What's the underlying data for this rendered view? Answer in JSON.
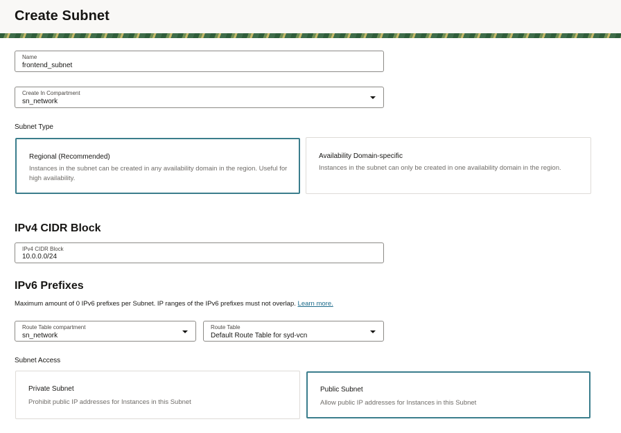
{
  "header": {
    "title": "Create Subnet"
  },
  "name_field": {
    "label": "Name",
    "value": "frontend_subnet"
  },
  "compartment_field": {
    "label": "Create In Compartment",
    "value": "sn_network"
  },
  "subnet_type": {
    "label": "Subnet Type",
    "options": [
      {
        "title": "Regional (Recommended)",
        "description": "Instances in the subnet can be created in any availability domain in the region. Useful for high availability.",
        "selected": true
      },
      {
        "title": "Availability Domain-specific",
        "description": "Instances in the subnet can only be created in one availability domain in the region.",
        "selected": false
      }
    ]
  },
  "ipv4": {
    "heading": "IPv4 CIDR Block",
    "field": {
      "label": "IPv4 CIDR Block",
      "value": "10.0.0.0/24"
    }
  },
  "ipv6": {
    "heading": "IPv6 Prefixes",
    "description": "Maximum amount of 0 IPv6 prefixes per Subnet. IP ranges of the IPv6 prefixes must not overlap.",
    "link": "Learn more."
  },
  "route_table_compartment": {
    "label": "Route Table compartment",
    "value": "sn_network"
  },
  "route_table": {
    "label": "Route Table",
    "value": "Default Route Table for syd-vcn"
  },
  "subnet_access": {
    "label": "Subnet Access",
    "options": [
      {
        "title": "Private Subnet",
        "description": "Prohibit public IP addresses for Instances in this Subnet",
        "selected": false
      },
      {
        "title": "Public Subnet",
        "description": "Allow public IP addresses for Instances in this Subnet",
        "selected": true
      }
    ]
  },
  "colors": {
    "accent": "#3a7d8c",
    "link": "#1b6a8a"
  }
}
